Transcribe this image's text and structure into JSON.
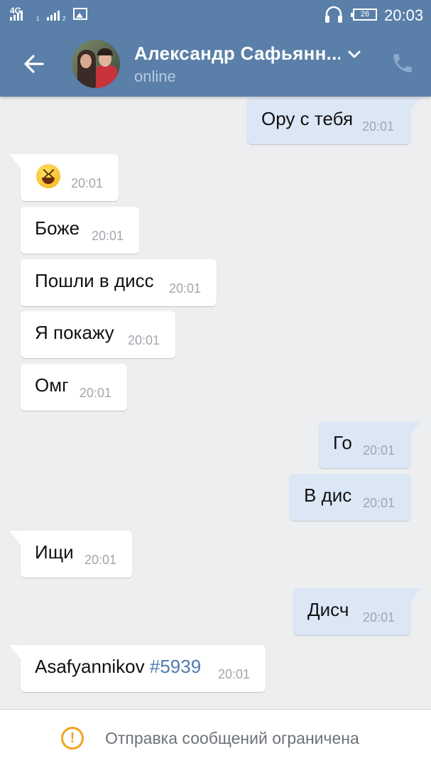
{
  "status_bar": {
    "network": "4G",
    "sim1": "1",
    "sim2": "2",
    "battery": "26",
    "time": "20:03"
  },
  "header": {
    "contact_name": "Александр Сафьянн...",
    "status": "online"
  },
  "messages": [
    {
      "dir": "out",
      "text": "Ору с тебя",
      "time": "20:01"
    },
    {
      "dir": "in",
      "emoji": "laughing-face",
      "time": "20:01"
    },
    {
      "dir": "in",
      "text": "Боже",
      "time": "20:01"
    },
    {
      "dir": "in",
      "text": "Пошли в дисс",
      "time": "20:01"
    },
    {
      "dir": "in",
      "text": "Я покажу",
      "time": "20:01"
    },
    {
      "dir": "in",
      "text": "Омг",
      "time": "20:01"
    },
    {
      "dir": "out",
      "text": "Го",
      "time": "20:01"
    },
    {
      "dir": "out",
      "text": "В дис",
      "time": "20:01"
    },
    {
      "dir": "in",
      "text": "Ищи",
      "time": "20:01"
    },
    {
      "dir": "out",
      "text": "Дисч",
      "time": "20:01"
    },
    {
      "dir": "in",
      "text": "Asafyannikov ",
      "hashtag": "#5939",
      "time": "20:01"
    }
  ],
  "footer": {
    "notice": "Отправка сообщений ограничена"
  },
  "colors": {
    "header": "#5a7fa9",
    "background": "#edeef0",
    "incoming": "#ffffff",
    "outgoing": "#dce7f6",
    "hashtag": "#4f7cb0",
    "warning": "#f3a21e"
  },
  "icons": [
    "back-arrow-icon",
    "chevron-down-icon",
    "phone-icon",
    "warning-icon",
    "headphones-icon",
    "battery-icon",
    "image-icon",
    "signal-icon"
  ]
}
